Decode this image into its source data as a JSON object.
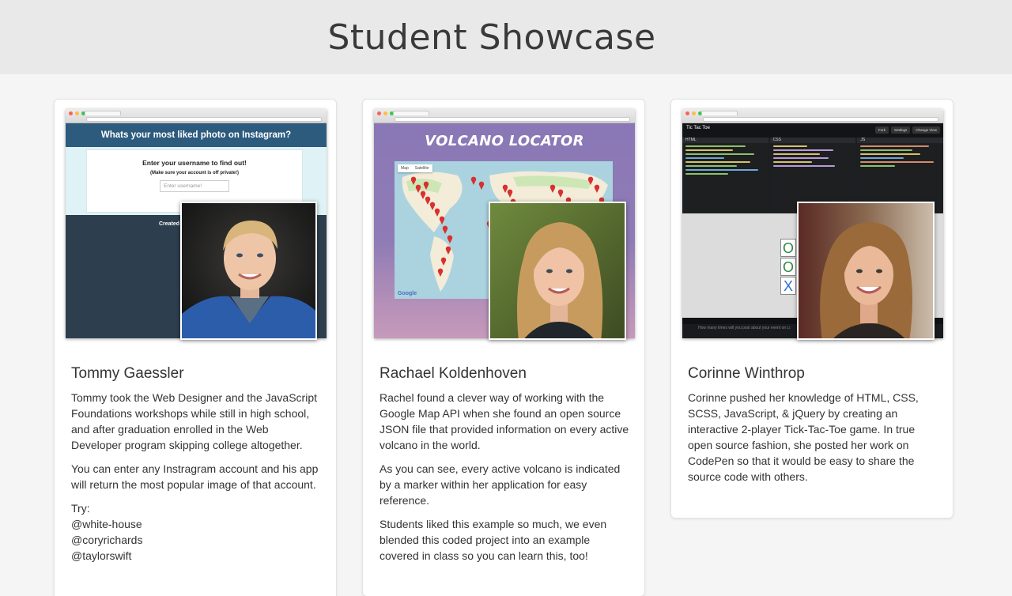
{
  "page": {
    "title": "Student Showcase"
  },
  "students": [
    {
      "name": "Tommy Gaessler",
      "paragraphs": [
        "Tommy took the Web Designer and the JavaScript Foundations workshops while still in high school, and after graduation enrolled in the Web Developer program skipping college altogether.",
        "You can enter any Instragram account and his app will return the most popular image of that account."
      ],
      "try_label": "Try:",
      "try_accounts": [
        "@white-house",
        "@coryrichards",
        "@taylorswift"
      ],
      "project": {
        "heading": "Whats your most liked photo on Instagram?",
        "prompt": "Enter your username to find out!",
        "note": "(Make sure your account is off private!)",
        "input_placeholder": "Enter username!",
        "footer_text": "Created"
      }
    },
    {
      "name": "Rachael Koldenhoven",
      "paragraphs": [
        "Rachel found a clever way of working with the Google Map API when she found an open source JSON file that provided information on every active volcano in the world.",
        "As you can see, every active volcano is indicated by a marker within her application for easy reference.",
        "Students liked this example so much, we even blended this coded project into an example covered in class so you can learn this, too!"
      ],
      "project": {
        "heading": "VOLCANO LOCATOR",
        "map_type_buttons": [
          "Map",
          "Satellite"
        ],
        "map_credit": "Google"
      }
    },
    {
      "name": "Corinne Winthrop",
      "paragraphs": [
        "Corinne pushed her knowledge of HTML, CSS, SCSS, JavaScript, & jQuery by creating an interactive 2-player Tick-Tac-Toe game. In true open source fashion, she posted her work on CodePen so that it would be easy to share the source code with others."
      ],
      "project": {
        "app_title": "Tic Tac Toe",
        "toolbar_buttons": [
          "Fork",
          "Settings",
          "Change View"
        ],
        "panes": [
          "HTML",
          "CSS",
          "JS"
        ],
        "board_cells": [
          "O",
          "O",
          "X"
        ],
        "footer_text": "How many times will you post about your event on Li"
      }
    }
  ],
  "colors": {
    "header_bg": "#e9e9e9",
    "instagram_bar": "#2c5b7e",
    "volcano_bg": "#8a78b6",
    "tictactoe_o": "#2e8b3e",
    "tictactoe_x": "#2a6fd0"
  }
}
